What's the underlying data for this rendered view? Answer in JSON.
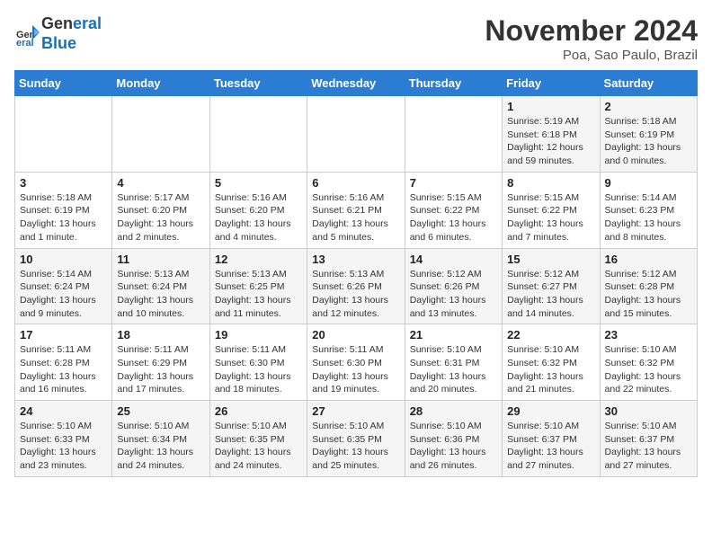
{
  "header": {
    "logo_line1": "General",
    "logo_line2": "Blue",
    "month": "November 2024",
    "location": "Poa, Sao Paulo, Brazil"
  },
  "days_of_week": [
    "Sunday",
    "Monday",
    "Tuesday",
    "Wednesday",
    "Thursday",
    "Friday",
    "Saturday"
  ],
  "weeks": [
    [
      {
        "day": "",
        "info": ""
      },
      {
        "day": "",
        "info": ""
      },
      {
        "day": "",
        "info": ""
      },
      {
        "day": "",
        "info": ""
      },
      {
        "day": "",
        "info": ""
      },
      {
        "day": "1",
        "info": "Sunrise: 5:19 AM\nSunset: 6:18 PM\nDaylight: 12 hours\nand 59 minutes."
      },
      {
        "day": "2",
        "info": "Sunrise: 5:18 AM\nSunset: 6:19 PM\nDaylight: 13 hours\nand 0 minutes."
      }
    ],
    [
      {
        "day": "3",
        "info": "Sunrise: 5:18 AM\nSunset: 6:19 PM\nDaylight: 13 hours\nand 1 minute."
      },
      {
        "day": "4",
        "info": "Sunrise: 5:17 AM\nSunset: 6:20 PM\nDaylight: 13 hours\nand 2 minutes."
      },
      {
        "day": "5",
        "info": "Sunrise: 5:16 AM\nSunset: 6:20 PM\nDaylight: 13 hours\nand 4 minutes."
      },
      {
        "day": "6",
        "info": "Sunrise: 5:16 AM\nSunset: 6:21 PM\nDaylight: 13 hours\nand 5 minutes."
      },
      {
        "day": "7",
        "info": "Sunrise: 5:15 AM\nSunset: 6:22 PM\nDaylight: 13 hours\nand 6 minutes."
      },
      {
        "day": "8",
        "info": "Sunrise: 5:15 AM\nSunset: 6:22 PM\nDaylight: 13 hours\nand 7 minutes."
      },
      {
        "day": "9",
        "info": "Sunrise: 5:14 AM\nSunset: 6:23 PM\nDaylight: 13 hours\nand 8 minutes."
      }
    ],
    [
      {
        "day": "10",
        "info": "Sunrise: 5:14 AM\nSunset: 6:24 PM\nDaylight: 13 hours\nand 9 minutes."
      },
      {
        "day": "11",
        "info": "Sunrise: 5:13 AM\nSunset: 6:24 PM\nDaylight: 13 hours\nand 10 minutes."
      },
      {
        "day": "12",
        "info": "Sunrise: 5:13 AM\nSunset: 6:25 PM\nDaylight: 13 hours\nand 11 minutes."
      },
      {
        "day": "13",
        "info": "Sunrise: 5:13 AM\nSunset: 6:26 PM\nDaylight: 13 hours\nand 12 minutes."
      },
      {
        "day": "14",
        "info": "Sunrise: 5:12 AM\nSunset: 6:26 PM\nDaylight: 13 hours\nand 13 minutes."
      },
      {
        "day": "15",
        "info": "Sunrise: 5:12 AM\nSunset: 6:27 PM\nDaylight: 13 hours\nand 14 minutes."
      },
      {
        "day": "16",
        "info": "Sunrise: 5:12 AM\nSunset: 6:28 PM\nDaylight: 13 hours\nand 15 minutes."
      }
    ],
    [
      {
        "day": "17",
        "info": "Sunrise: 5:11 AM\nSunset: 6:28 PM\nDaylight: 13 hours\nand 16 minutes."
      },
      {
        "day": "18",
        "info": "Sunrise: 5:11 AM\nSunset: 6:29 PM\nDaylight: 13 hours\nand 17 minutes."
      },
      {
        "day": "19",
        "info": "Sunrise: 5:11 AM\nSunset: 6:30 PM\nDaylight: 13 hours\nand 18 minutes."
      },
      {
        "day": "20",
        "info": "Sunrise: 5:11 AM\nSunset: 6:30 PM\nDaylight: 13 hours\nand 19 minutes."
      },
      {
        "day": "21",
        "info": "Sunrise: 5:10 AM\nSunset: 6:31 PM\nDaylight: 13 hours\nand 20 minutes."
      },
      {
        "day": "22",
        "info": "Sunrise: 5:10 AM\nSunset: 6:32 PM\nDaylight: 13 hours\nand 21 minutes."
      },
      {
        "day": "23",
        "info": "Sunrise: 5:10 AM\nSunset: 6:32 PM\nDaylight: 13 hours\nand 22 minutes."
      }
    ],
    [
      {
        "day": "24",
        "info": "Sunrise: 5:10 AM\nSunset: 6:33 PM\nDaylight: 13 hours\nand 23 minutes."
      },
      {
        "day": "25",
        "info": "Sunrise: 5:10 AM\nSunset: 6:34 PM\nDaylight: 13 hours\nand 24 minutes."
      },
      {
        "day": "26",
        "info": "Sunrise: 5:10 AM\nSunset: 6:35 PM\nDaylight: 13 hours\nand 24 minutes."
      },
      {
        "day": "27",
        "info": "Sunrise: 5:10 AM\nSunset: 6:35 PM\nDaylight: 13 hours\nand 25 minutes."
      },
      {
        "day": "28",
        "info": "Sunrise: 5:10 AM\nSunset: 6:36 PM\nDaylight: 13 hours\nand 26 minutes."
      },
      {
        "day": "29",
        "info": "Sunrise: 5:10 AM\nSunset: 6:37 PM\nDaylight: 13 hours\nand 27 minutes."
      },
      {
        "day": "30",
        "info": "Sunrise: 5:10 AM\nSunset: 6:37 PM\nDaylight: 13 hours\nand 27 minutes."
      }
    ]
  ]
}
